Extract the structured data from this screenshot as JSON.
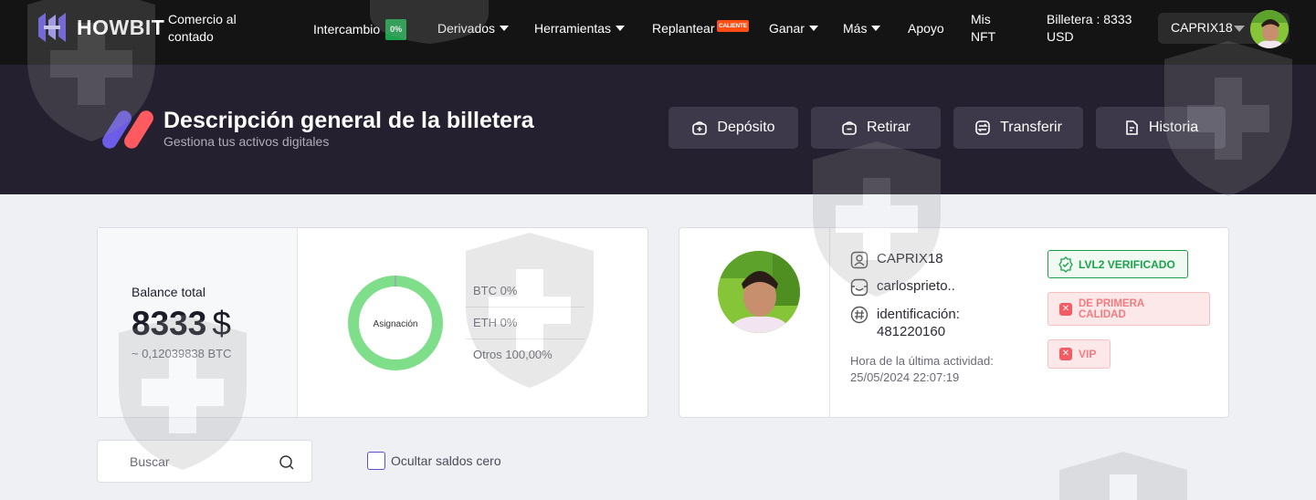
{
  "nav": {
    "brand": "HOWBIT",
    "spot": "Comercio al contado",
    "exchange": "Intercambio",
    "exchange_badge": "0%",
    "derivatives": "Derivados",
    "tools": "Herramientas",
    "launch": "Replantear",
    "launch_badge": "CALIENTE",
    "earn": "Ganar",
    "more": "Más",
    "support": "Apoyo",
    "nft": "Mis NFT",
    "wallet_balance": "Billetera : 8333 USD",
    "username": "CAPRIX18"
  },
  "header": {
    "title": "Descripción general de la billetera",
    "subtitle": "Gestiona tus activos digitales",
    "actions": {
      "deposit": "Depósito",
      "withdraw": "Retirar",
      "transfer": "Transferir",
      "history": "Historia"
    }
  },
  "balance": {
    "label": "Balance total",
    "value": "8333",
    "currency_symbol": "$",
    "btc_equivalent": "~ 0,12039838 BTC",
    "donut_label": "Asignación",
    "allocation": [
      {
        "label": "BTC 0%",
        "percent": 0,
        "color": "#9aa0b5"
      },
      {
        "label": "ETH 0%",
        "percent": 0,
        "color": "#7b6fd8"
      },
      {
        "label": "Otros 100,00%",
        "percent": 100,
        "color": "#7ede8a"
      }
    ]
  },
  "profile": {
    "username": "CAPRIX18",
    "email": "carlosprieto..",
    "id_label": "identificación:",
    "id_value": "481220160",
    "last_activity_label": "Hora de la última actividad:",
    "last_activity_value": "25/05/2024 22:07:19",
    "badges": {
      "verified": "LVL2 VERIFICADO",
      "premium": "DE PRIMERA CALIDAD",
      "vip": "VIP"
    }
  },
  "filters": {
    "search_placeholder": "Buscar",
    "hide_zero": "Ocultar saldos cero"
  },
  "colors": {
    "nav_bg": "#141414",
    "header_bg": "#24202f",
    "accent_purple": "#6c5ce7",
    "accent_red": "#ff5a5f",
    "green": "#1aa34a"
  }
}
